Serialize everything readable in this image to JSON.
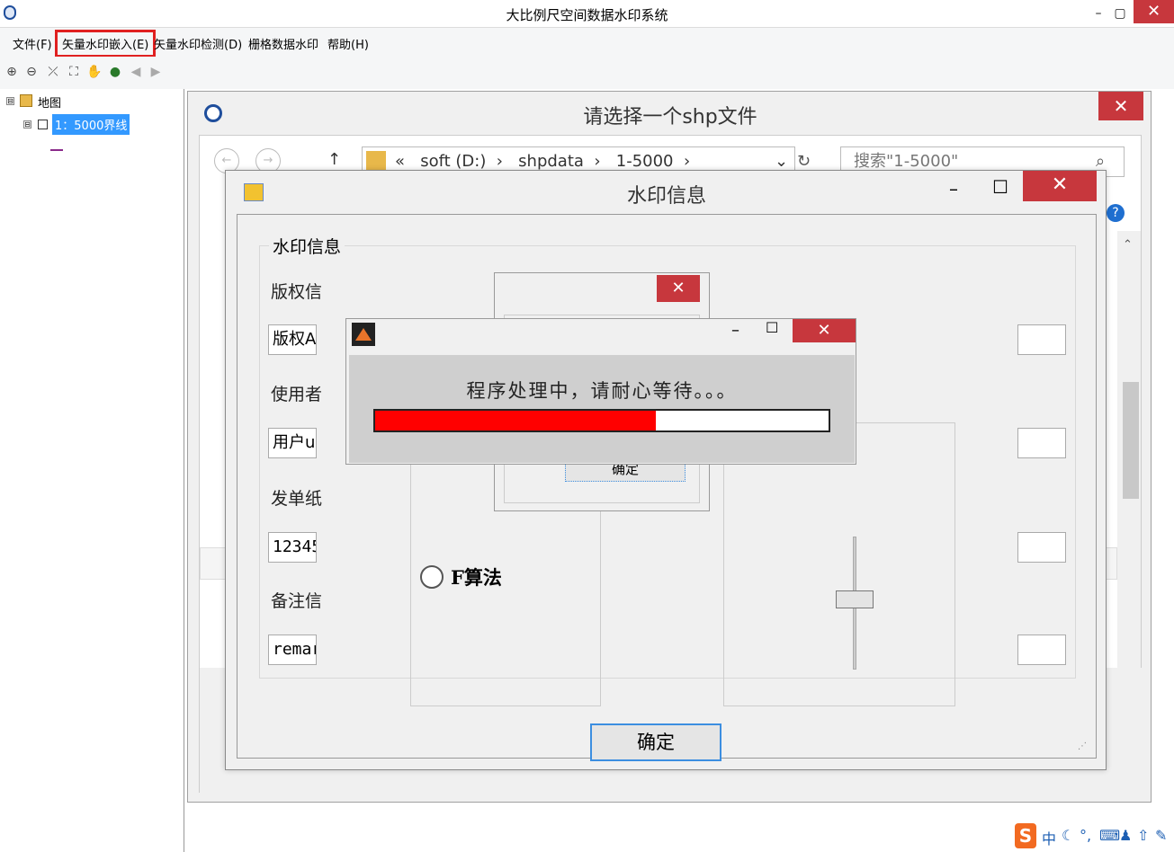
{
  "window": {
    "title": "大比例尺空间数据水印系统",
    "minimize": "–",
    "restore": "▢",
    "close": "✕"
  },
  "menu": [
    "文件(F)",
    "矢量水印嵌入(E)",
    "矢量水印检测(D)",
    "栅格数据水印",
    "帮助(H)"
  ],
  "toc": {
    "root": "地图",
    "layer": "1：5000界线",
    "root_toggle": "⊟",
    "layer_toggle": "⊟"
  },
  "file_dialog": {
    "title": "请选择一个shp文件",
    "close": "✕",
    "breadcrumb": [
      "«",
      "soft (D:)",
      "shpdata",
      "1-5000"
    ],
    "search_placeholder": "搜索\"1-5000\""
  },
  "watermark_dialog": {
    "title": "水印信息",
    "close": "✕",
    "minimize": "–",
    "maximize": "☐",
    "group_title": "水印信息",
    "fields": [
      {
        "label": "版权信",
        "value": "版权A"
      },
      {
        "label": "使用者",
        "value": "用户u"
      },
      {
        "label": "发单纸",
        "value": "12345"
      },
      {
        "label": "备注信",
        "value": "remar"
      }
    ],
    "algo_option": "F算法",
    "ok": "确定"
  },
  "message_dialog": {
    "close": "✕",
    "ok": "确定"
  },
  "progress_dialog": {
    "message": "程序处理中，请耐心等待。。。",
    "progress_percent": 62,
    "minimize": "–",
    "maximize": "☐",
    "close": "✕"
  },
  "ime": {
    "logo": "S",
    "mode": "中"
  },
  "colors": {
    "close_red": "#c7373d",
    "progress_fill": "#ff0000",
    "selection": "#3399ff",
    "highlight_border": "#e02020"
  }
}
